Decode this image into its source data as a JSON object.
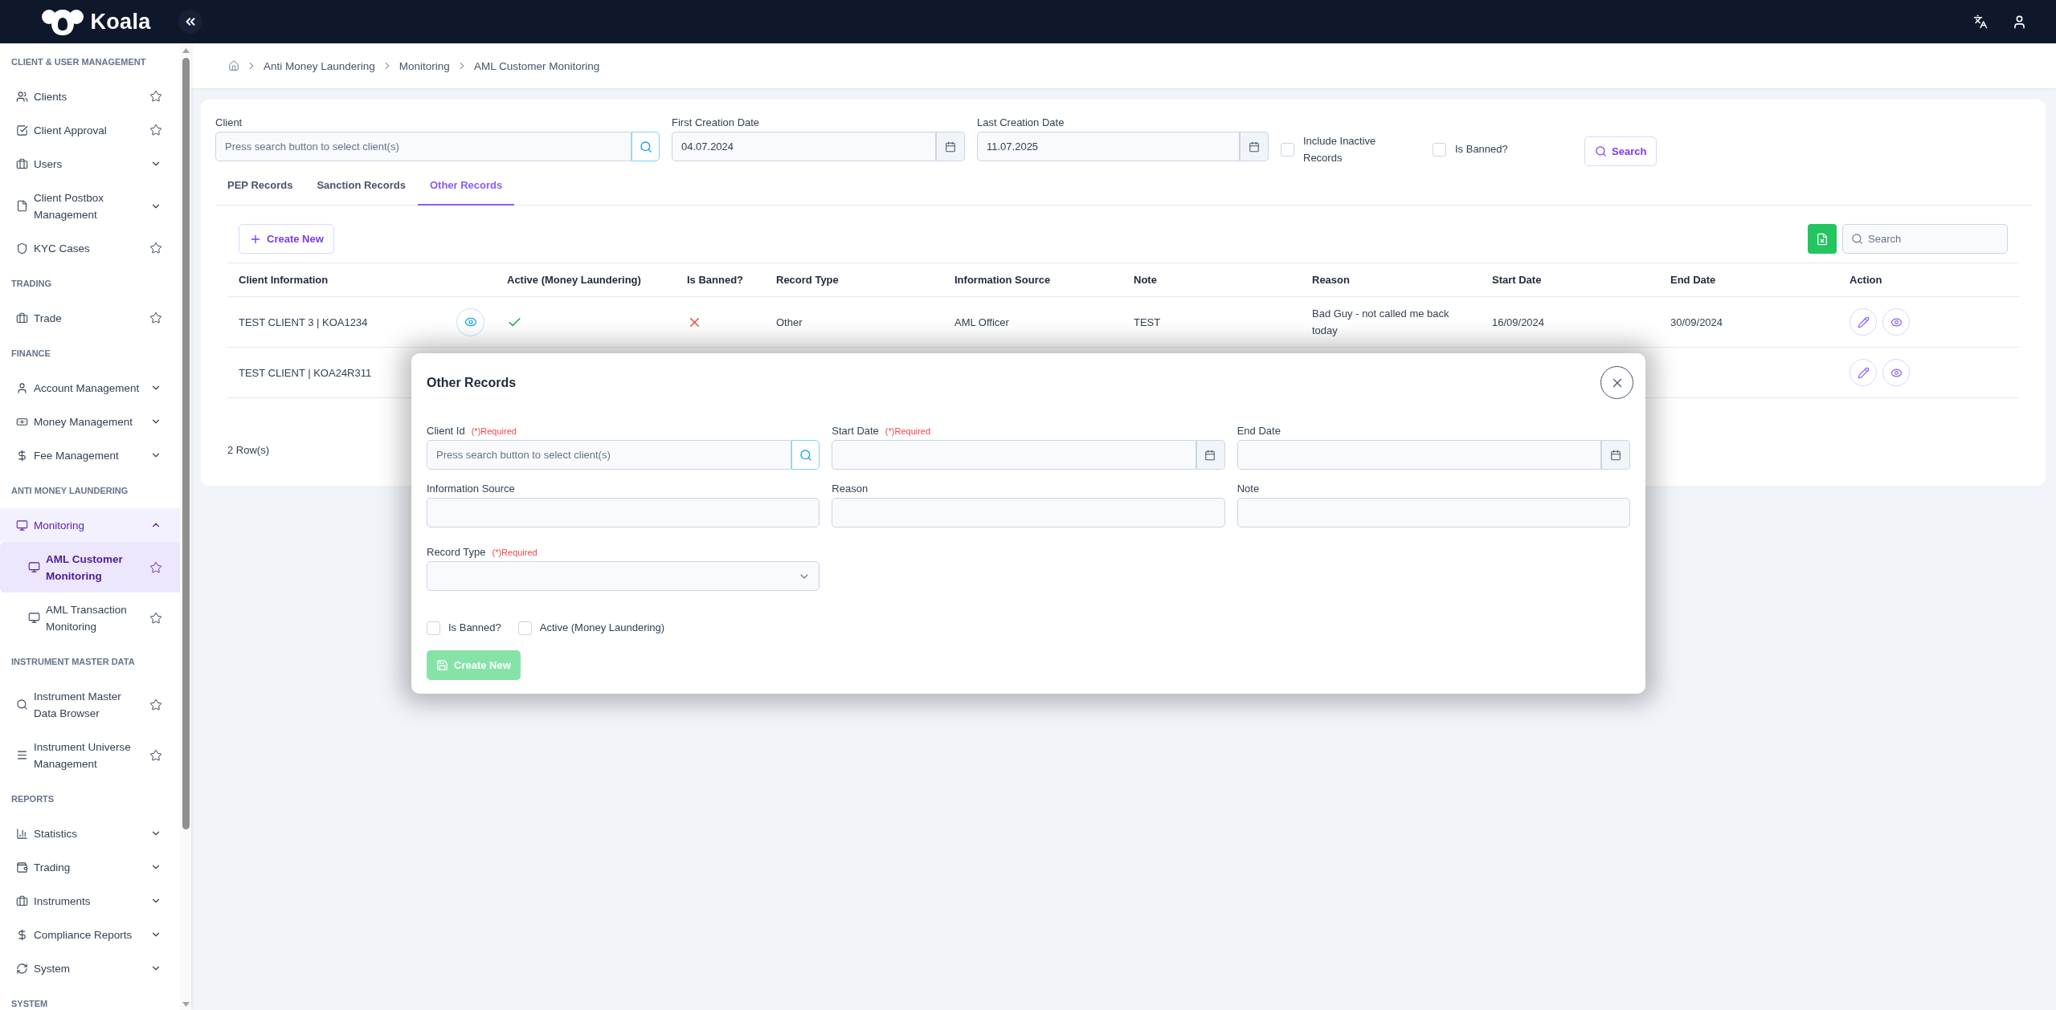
{
  "topbar": {
    "logo": "Koala"
  },
  "sidebar": {
    "sections": [
      {
        "title": "CLIENT & USER MANAGEMENT",
        "items": [
          {
            "label": "Clients",
            "kind": "link",
            "selected": false
          },
          {
            "label": "Client Approval",
            "kind": "link",
            "selected": false
          },
          {
            "label": "Users",
            "kind": "group",
            "expanded": false,
            "selected": false
          },
          {
            "label": "Client Postbox Management",
            "kind": "group",
            "expanded": false,
            "selected": false
          },
          {
            "label": "KYC Cases",
            "kind": "link",
            "selected": false
          }
        ]
      },
      {
        "title": "TRADING",
        "items": [
          {
            "label": "Trade",
            "kind": "link",
            "selected": false
          }
        ]
      },
      {
        "title": "FINANCE",
        "items": [
          {
            "label": "Account Management",
            "kind": "group",
            "expanded": false,
            "selected": false
          },
          {
            "label": "Money Management",
            "kind": "group",
            "expanded": false,
            "selected": false
          },
          {
            "label": "Fee Management",
            "kind": "group",
            "expanded": false,
            "selected": false
          }
        ]
      },
      {
        "title": "ANTI MONEY LAUNDERING",
        "items": [
          {
            "label": "Monitoring",
            "kind": "group",
            "expanded": true,
            "selected": false,
            "children": [
              {
                "label": "AML Customer Monitoring",
                "kind": "link",
                "selected": true
              },
              {
                "label": "AML Transaction Monitoring",
                "kind": "link",
                "selected": false
              }
            ]
          }
        ]
      },
      {
        "title": "INSTRUMENT MASTER DATA",
        "items": [
          {
            "label": "Instrument Master Data Browser",
            "kind": "link",
            "selected": false
          },
          {
            "label": "Instrument Universe Management",
            "kind": "link",
            "selected": false
          }
        ]
      },
      {
        "title": "REPORTS",
        "items": [
          {
            "label": "Statistics",
            "kind": "group",
            "expanded": false,
            "selected": false
          },
          {
            "label": "Trading",
            "kind": "group",
            "expanded": false,
            "selected": false
          },
          {
            "label": "Instruments",
            "kind": "group",
            "expanded": false,
            "selected": false
          },
          {
            "label": "Compliance Reports",
            "kind": "group",
            "expanded": false,
            "selected": false
          },
          {
            "label": "System",
            "kind": "group",
            "expanded": false,
            "selected": false
          }
        ]
      },
      {
        "title": "SYSTEM"
      }
    ]
  },
  "breadcrumb": [
    "Anti Money Laundering",
    "Monitoring",
    "AML Customer Monitoring"
  ],
  "filters": {
    "client": {
      "label": "Client",
      "placeholder": "Press search button to select client(s)"
    },
    "first_creation_date": {
      "label": "First Creation Date",
      "value": "04.07.2024"
    },
    "last_creation_date": {
      "label": "Last Creation Date",
      "value": "11.07.2025"
    },
    "include_inactive": {
      "label": "Include Inactive Records",
      "checked": false
    },
    "is_banned": {
      "label": "Is Banned?",
      "checked": false
    },
    "search_button": "Search"
  },
  "tabs": [
    {
      "label": "PEP Records",
      "selected": false
    },
    {
      "label": "Sanction Records",
      "selected": false
    },
    {
      "label": "Other Records",
      "selected": true
    }
  ],
  "toolbar": {
    "create_button": "Create New",
    "search": {
      "placeholder": "Search"
    }
  },
  "table": {
    "columns": [
      "Client Information",
      "Active (Money Laundering)",
      "Is Banned?",
      "Record Type",
      "Information Source",
      "Note",
      "Reason",
      "Start Date",
      "End Date",
      "Action"
    ],
    "rows": [
      {
        "client_information": "TEST CLIENT 3 | KOA1234",
        "preview_button": true,
        "active": true,
        "is_banned": false,
        "record_type": "Other",
        "information_source": "AML Officer",
        "note": "TEST",
        "reason": "Bad Guy - not called me back today",
        "start_date": "16/09/2024",
        "end_date": "30/09/2024"
      },
      {
        "client_information": "TEST CLIENT | KOA24R311"
      }
    ]
  },
  "row_count": "2 Row(s)",
  "modal": {
    "title": "Other Records",
    "fields": [
      {
        "label": "Client Id",
        "required": "(*)Required",
        "kind": "lookup",
        "placeholder": "Press search button to select client(s)"
      },
      {
        "label": "Start Date",
        "required": "(*)Required",
        "kind": "date"
      },
      {
        "label": "End Date",
        "kind": "date"
      },
      {
        "label": "Information Source",
        "kind": "text"
      },
      {
        "label": "Reason",
        "kind": "text"
      },
      {
        "label": "Note",
        "kind": "text"
      },
      {
        "label": "Record Type",
        "required": "(*)Required",
        "kind": "select"
      }
    ],
    "checkboxes": [
      {
        "label": "Is Banned?",
        "checked": false
      },
      {
        "label": "Active (Money Laundering)",
        "checked": false
      }
    ],
    "submit": {
      "label": "Create New",
      "disabled": true
    }
  }
}
